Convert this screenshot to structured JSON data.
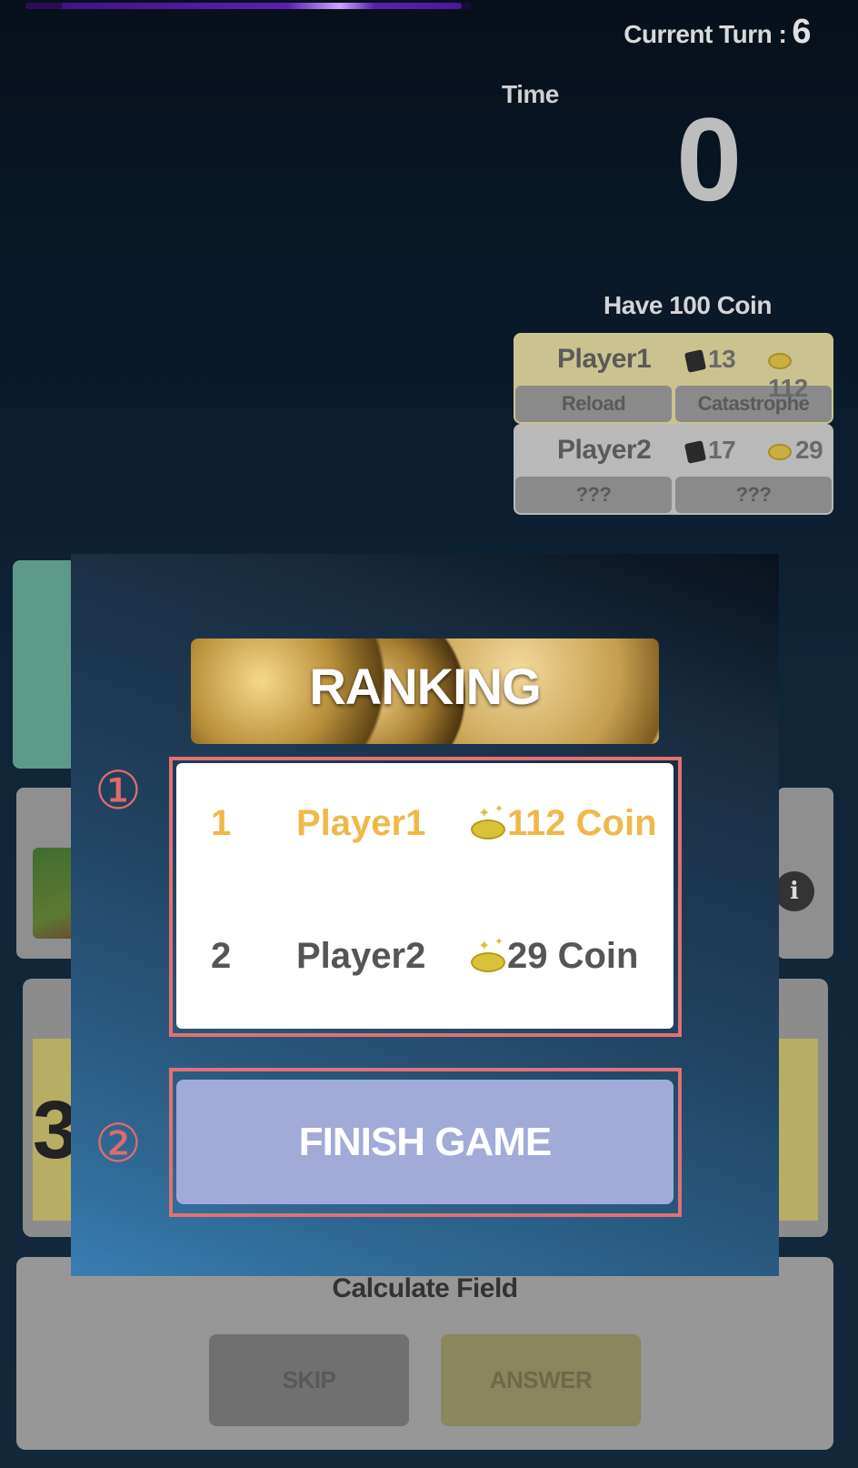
{
  "progress": {
    "fill_fraction": 0.98
  },
  "header": {
    "turn_label": "Current Turn :",
    "turn_value": "6",
    "time_label": "Time",
    "time_value": "0"
  },
  "coin_goal": "Have 100 Coin",
  "players": [
    {
      "name": "Player1",
      "cards": "13",
      "coins": "112",
      "sub": [
        "Reload",
        "Catastrophe"
      ]
    },
    {
      "name": "Player2",
      "cards": "17",
      "coins": "29",
      "sub": [
        "???",
        "???"
      ]
    }
  ],
  "board": {
    "hand_tile_value": "3"
  },
  "calc": {
    "title": "Calculate Field",
    "skip": "SKIP",
    "answer": "ANSWER"
  },
  "modal": {
    "title": "RANKING",
    "markers": [
      "①",
      "②"
    ],
    "ranking": [
      {
        "rank": "1",
        "name": "Player1",
        "coins": "112 Coin"
      },
      {
        "rank": "2",
        "name": "Player2",
        "coins": "29 Coin"
      }
    ],
    "finish_button": "FINISH GAME"
  },
  "colors": {
    "first_place": "#f0b84a",
    "highlight_border": "#e27171",
    "finish_button": "#a2aad8"
  }
}
